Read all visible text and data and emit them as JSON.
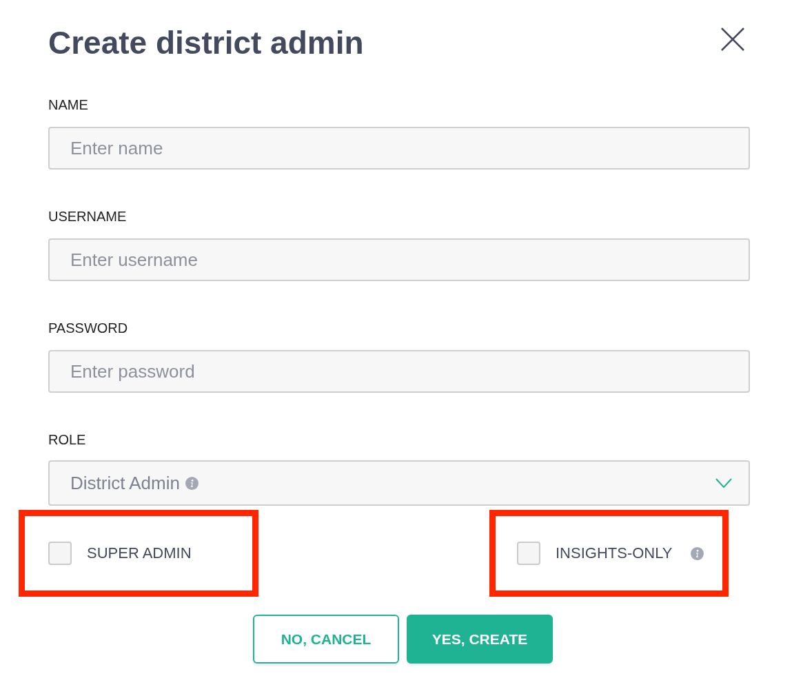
{
  "dialog": {
    "title": "Create district admin"
  },
  "fields": [
    {
      "kind": "text",
      "label": "NAME",
      "placeholder": "Enter name"
    },
    {
      "kind": "text",
      "label": "USERNAME",
      "placeholder": "Enter username"
    },
    {
      "kind": "text",
      "label": "PASSWORD",
      "placeholder": "Enter password"
    },
    {
      "kind": "select",
      "label": "ROLE",
      "value": "District Admin",
      "info": true
    }
  ],
  "options": [
    {
      "label": "SUPER ADMIN",
      "checked": false,
      "highlighted": true
    },
    {
      "label": "INSIGHTS-ONLY",
      "checked": false,
      "highlighted": true,
      "info": true
    }
  ],
  "buttons": [
    {
      "label": "NO, CANCEL",
      "kind": "secondary"
    },
    {
      "label": "YES, CREATE",
      "kind": "primary"
    }
  ]
}
